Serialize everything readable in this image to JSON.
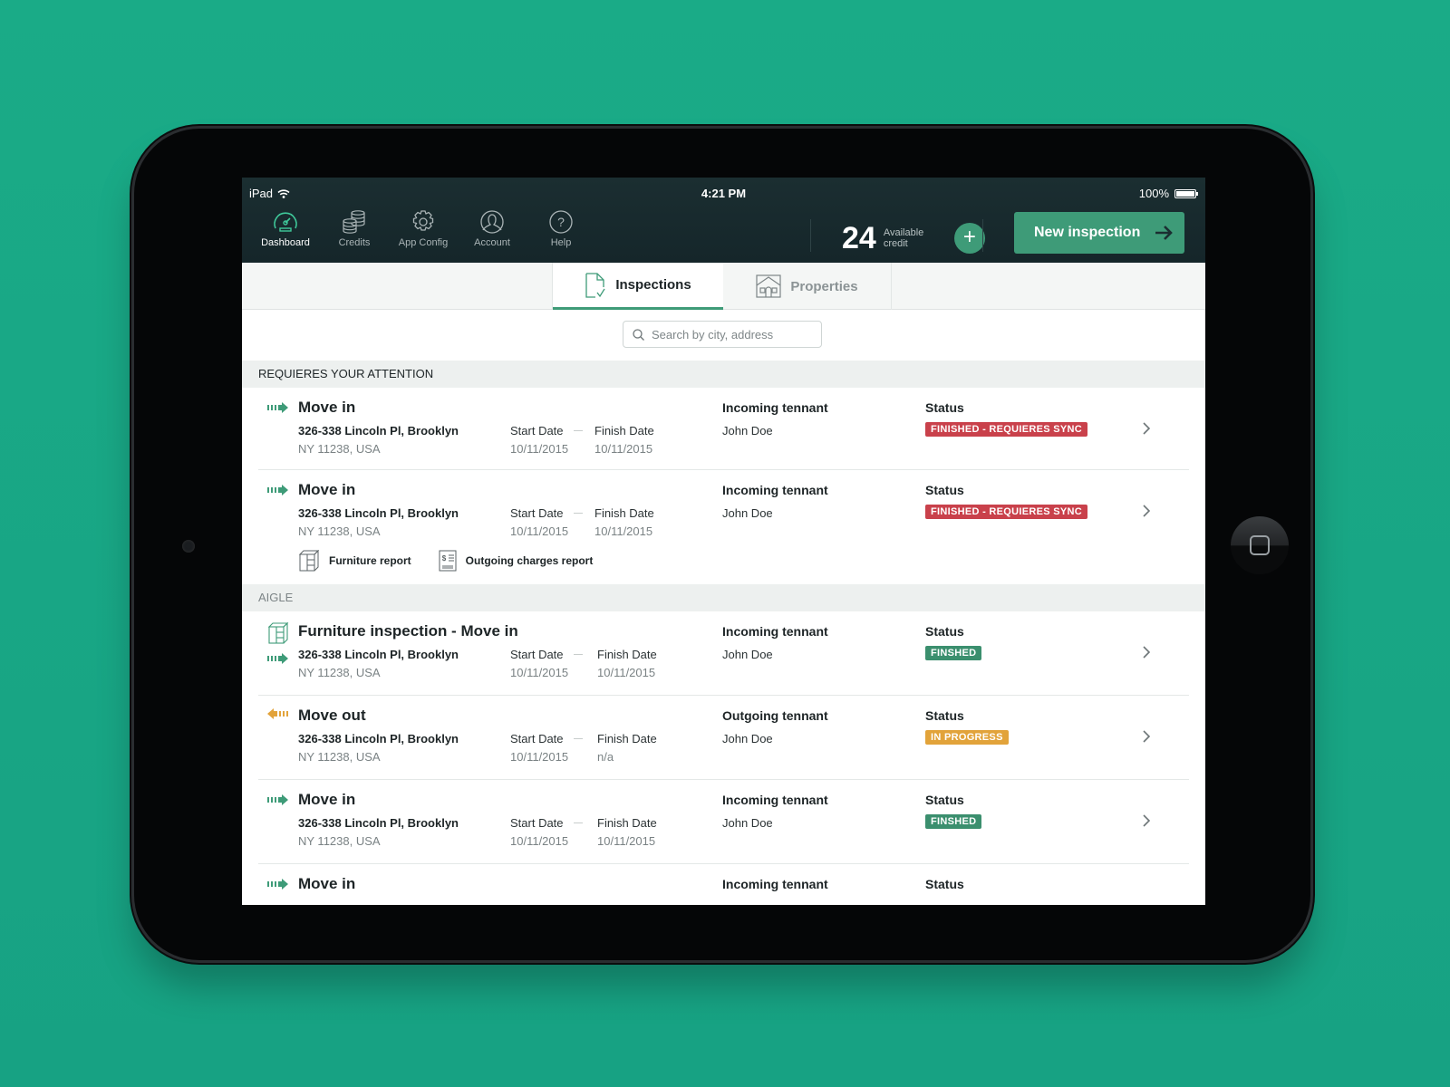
{
  "status_bar": {
    "device": "iPad",
    "time": "4:21 PM",
    "battery": "100%",
    "battery_level": 1.0
  },
  "nav": {
    "items": [
      {
        "label": "Dashboard",
        "icon": "speedometer-icon",
        "active": true
      },
      {
        "label": "Credits",
        "icon": "coins-icon",
        "active": false
      },
      {
        "label": "App Config",
        "icon": "gear-icon",
        "active": false
      },
      {
        "label": "Account",
        "icon": "user-icon",
        "active": false
      },
      {
        "label": "Help",
        "icon": "help-icon",
        "active": false
      }
    ]
  },
  "credit": {
    "value": "24",
    "label_line1": "Available",
    "label_line2": "credit",
    "add_label": "+"
  },
  "new_inspection": {
    "label": "New inspection",
    "icon": "arrow-right-icon"
  },
  "tabs": [
    {
      "label": "Inspections",
      "icon": "document-check-icon",
      "active": true
    },
    {
      "label": "Properties",
      "icon": "house-icon",
      "active": false
    }
  ],
  "search": {
    "placeholder": "Search by city, address",
    "value": ""
  },
  "colors": {
    "accent": "#3e9b78",
    "badge_red": "#c9414b",
    "badge_green": "#3b8f6e",
    "badge_orange": "#e2a33a",
    "background": "#1aab87"
  },
  "sections": [
    {
      "title": "REQUIERES YOUR ATTENTION",
      "rows": [
        {
          "type_icon": "move-in-arrow-icon",
          "title": "Move in",
          "address_line1": "326-338 Lincoln Pl, Brooklyn",
          "address_line2": "NY 11238, USA",
          "start_label": "Start Date",
          "start_value": "10/11/2015",
          "finish_label": "Finish Date",
          "finish_value": "10/11/2015",
          "tenant_label": "Incoming tennant",
          "tenant_value": "John Doe",
          "status_label": "Status",
          "status": "FINISHED - REQUIERES SYNC",
          "status_color": "red"
        },
        {
          "type_icon": "move-in-arrow-icon",
          "title": "Move in",
          "address_line1": "326-338 Lincoln Pl, Brooklyn",
          "address_line2": "NY 11238, USA",
          "start_label": "Start Date",
          "start_value": "10/11/2015",
          "finish_label": "Finish Date",
          "finish_value": "10/11/2015",
          "tenant_label": "Incoming tennant",
          "tenant_value": "John Doe",
          "status_label": "Status",
          "status": "FINISHED - REQUIERES SYNC",
          "status_color": "red",
          "reports": [
            {
              "label": "Furniture report",
              "icon": "furniture-icon"
            },
            {
              "label": "Outgoing charges report",
              "icon": "invoice-icon"
            }
          ]
        }
      ]
    },
    {
      "title": "AIGLE",
      "rows": [
        {
          "type_icon": "furniture-move-in-icon",
          "title": "Furniture inspection - Move in",
          "address_line1": "326-338 Lincoln Pl, Brooklyn",
          "address_line2": "NY 11238, USA",
          "start_label": "Start Date",
          "start_value": "10/11/2015",
          "finish_label": "Finish Date",
          "finish_value": "10/11/2015",
          "tenant_label": "Incoming tennant",
          "tenant_value": "John Doe",
          "status_label": "Status",
          "status": "FINSHED",
          "status_color": "green"
        },
        {
          "type_icon": "move-out-arrow-icon",
          "title": "Move out",
          "address_line1": "326-338 Lincoln Pl, Brooklyn",
          "address_line2": "NY 11238, USA",
          "start_label": "Start Date",
          "start_value": "10/11/2015",
          "finish_label": "Finish Date",
          "finish_value": "n/a",
          "tenant_label": "Outgoing tennant",
          "tenant_value": "John Doe",
          "status_label": "Status",
          "status": "IN PROGRESS",
          "status_color": "orange"
        },
        {
          "type_icon": "move-in-arrow-icon",
          "title": "Move in",
          "address_line1": "326-338 Lincoln Pl, Brooklyn",
          "address_line2": "NY 11238, USA",
          "start_label": "Start Date",
          "start_value": "10/11/2015",
          "finish_label": "Finish Date",
          "finish_value": "10/11/2015",
          "tenant_label": "Incoming tennant",
          "tenant_value": "John Doe",
          "status_label": "Status",
          "status": "FINSHED",
          "status_color": "green"
        },
        {
          "type_icon": "move-in-arrow-icon",
          "title": "Move in",
          "tenant_label": "Incoming tennant",
          "status_label": "Status"
        }
      ]
    }
  ]
}
